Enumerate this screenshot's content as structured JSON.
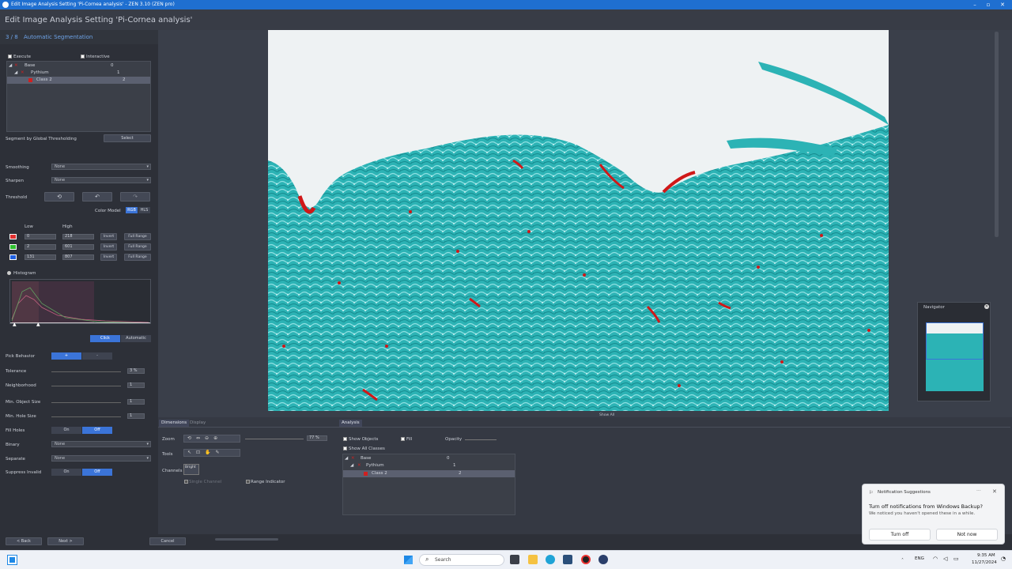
{
  "window": {
    "title": "Edit Image Analysis Setting 'Pi-Cornea analysis' - ZEN 3.10 (ZEN pro)"
  },
  "header": {
    "title": "Edit Image Analysis Setting 'Pi-Cornea analysis'"
  },
  "step": {
    "number": "3 / 8",
    "name": "Automatic Segmentation"
  },
  "left": {
    "execute_label": "Execute",
    "interactive_label": "Interactive",
    "tree": [
      {
        "name": "Base",
        "count": "0",
        "color": "#d02020"
      },
      {
        "name": "Pythium",
        "count": "1",
        "color": "#d02020"
      },
      {
        "name": "Class 2",
        "count": "2",
        "color": "#d02020"
      }
    ],
    "segment_label": "Segment by Global Thresholding",
    "select_label": "Select",
    "smoothing_label": "Smoothing",
    "smoothing_value": "None",
    "sharpen_label": "Sharpen",
    "sharpen_value": "None",
    "threshold_label": "Threshold",
    "color_model_label": "Color Model",
    "rgb": "RGB",
    "hls": "HLS",
    "low_label": "Low",
    "high_label": "High",
    "channels": [
      {
        "color": "#e03030",
        "low": "0",
        "high": "218"
      },
      {
        "color": "#30c030",
        "low": "2",
        "high": "601"
      },
      {
        "color": "#2060e0",
        "low": "131",
        "high": "807"
      }
    ],
    "invert_label": "Invert",
    "full_range_label": "Full Range",
    "histogram_label": "Histogram",
    "click_label": "Click",
    "automatic_label": "Automatic",
    "pick_behavior_label": "Pick Behavior",
    "pick_plus": "+",
    "pick_minus": "-",
    "tolerance_label": "Tolerance",
    "tolerance_value": "3 %",
    "neighborhood_label": "Neighborhood",
    "neighborhood_value": "1",
    "min_object_label": "Min. Object Size",
    "min_object_value": "1",
    "min_hole_label": "Min. Hole Size",
    "min_hole_value": "1",
    "fill_holes_label": "Fill Holes",
    "binary_label": "Binary",
    "binary_value": "None",
    "separate_label": "Separate",
    "separate_value": "None",
    "suppress_label": "Suppress Invalid",
    "on": "On",
    "off": "Off"
  },
  "footer": {
    "back": "< Back",
    "next": "Next >",
    "cancel": "Cancel"
  },
  "show_all": "Show All",
  "navigator": {
    "title": "Navigator"
  },
  "bottom": {
    "tab_dimensions": "Dimensions",
    "tab_display": "Display",
    "tab_analysis": "Analysis",
    "zoom_label": "Zoom",
    "zoom_value": "77 %",
    "tools_label": "Tools",
    "channels_label": "Channels",
    "channel_name": "Bright",
    "single_channel": "Single Channel",
    "range_indicator": "Range Indicator",
    "show_objects": "Show Objects",
    "fill": "Fill",
    "opacity": "Opacity",
    "show_all_classes": "Show All Classes",
    "tree": [
      {
        "name": "Base",
        "count": "0"
      },
      {
        "name": "Pythium",
        "count": "1"
      },
      {
        "name": "Class 2",
        "count": "2"
      }
    ]
  },
  "toast": {
    "header": "Notification Suggestions",
    "title": "Turn off notifications from Windows Backup?",
    "body": "We noticed you haven't opened these in a while.",
    "turn_off": "Turn off",
    "not_now": "Not now"
  },
  "taskbar": {
    "search": "Search",
    "lang": "ENG",
    "time": "9:35 AM",
    "date": "11/27/2024"
  }
}
